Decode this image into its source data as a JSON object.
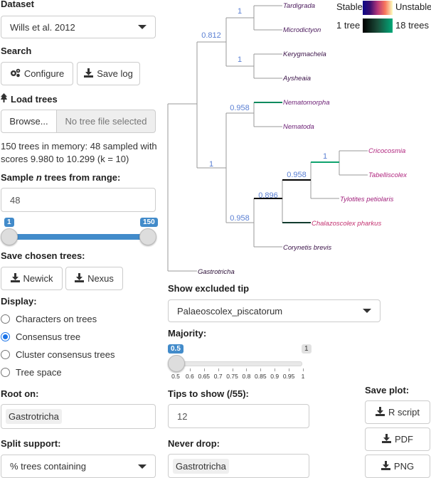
{
  "sidebar": {
    "dataset_label": "Dataset",
    "dataset_value": "Wills et al. 2012",
    "search_label": "Search",
    "configure_label": "Configure",
    "save_log_label": "Save log",
    "load_trees_label": "Load trees",
    "browse_label": "Browse...",
    "file_placeholder": "No tree file selected",
    "memory_text": "150 trees in memory: 48 sampled with scores 9.980 to 10.299 (k = 10)",
    "sample_label_pre": "Sample ",
    "sample_label_n": "n",
    "sample_label_post": " trees from range:",
    "sample_value": "48",
    "range_min": "1",
    "range_max": "150",
    "save_chosen_label": "Save chosen trees:",
    "newick_label": "Newick",
    "nexus_label": "Nexus",
    "display_label": "Display:",
    "display_options": [
      "Characters on trees",
      "Consensus tree",
      "Cluster consensus trees",
      "Tree space"
    ],
    "display_selected": 1,
    "root_on_label": "Root on:",
    "root_on_value": "Gastrotricha",
    "split_support_label": "Split support:",
    "split_support_value": "% trees containing"
  },
  "legend": {
    "stable": "Stable",
    "unstable": "Unstable",
    "one_tree": "1 tree",
    "eighteen_trees": "18 trees"
  },
  "tree": {
    "tips": [
      "Tardigrada",
      "Microdictyon",
      "Kerygmachela",
      "Aysheaia",
      "Nematomorpha",
      "Nematoda",
      "Cricocosmia",
      "Tabelliscolex",
      "Tylotites petiolaris",
      "Chalazoscolex pharkus",
      "Corynetis brevis",
      "Gastrotricha"
    ],
    "supports": [
      "1",
      "0.812",
      "1",
      "0.958",
      "1",
      "1",
      "0.958",
      "0.896",
      "0.958"
    ]
  },
  "controls": {
    "show_excluded_label": "Show excluded tip",
    "show_excluded_value": "Palaeoscolex_piscatorum",
    "majority_label": "Majority:",
    "majority_value": "0.5",
    "majority_max": "1",
    "majority_ticks": [
      "0.5",
      "0.6",
      "0.65",
      "0.7",
      "0.75",
      "0.8",
      "0.85",
      "0.9",
      "0.95",
      "1"
    ],
    "majority_fraction": 0,
    "tips_to_show_label": "Tips to show (/55):",
    "tips_to_show_value": "12",
    "never_drop_label": "Never drop:",
    "never_drop_value": "Gastrotricha",
    "save_plot_label": "Save plot:",
    "r_script_label": "R script",
    "pdf_label": "PDF",
    "png_label": "PNG"
  }
}
